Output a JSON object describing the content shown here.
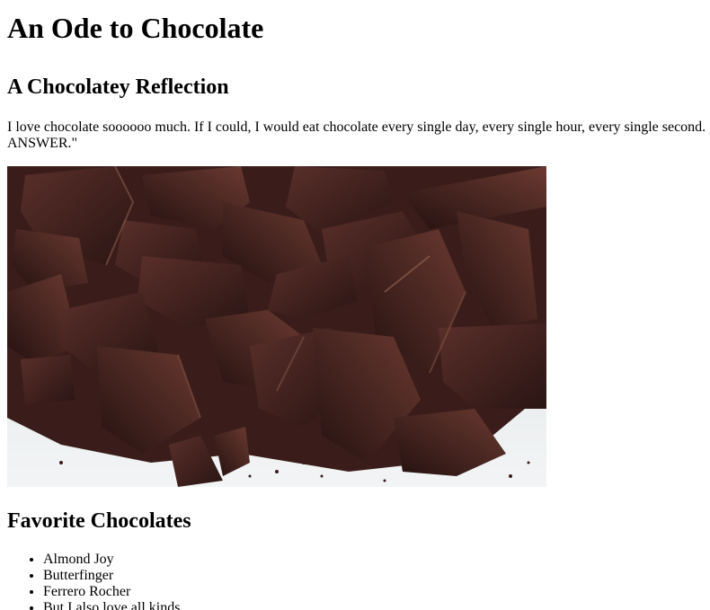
{
  "page": {
    "title": "An Ode to Chocolate",
    "reflection_heading": "A Chocolatey Reflection",
    "intro_text": "I love chocolate soooooo much. If I could, I would eat chocolate every single day, every single hour, every single second. “ANSWER.\"",
    "image_alt": "chocolate pieces",
    "favorites_heading": "Favorite Chocolates",
    "favorites": [
      "Almond Joy",
      "Butterfinger",
      "Ferrero Rocher",
      "But I also love all kinds."
    ]
  },
  "colors": {
    "background": "#ffffff",
    "text": "#000000",
    "chocolate_dark": "#2a1614",
    "chocolate_mid": "#4a2724",
    "chocolate_light": "#7a4a3c",
    "surface": "#eef1f3"
  }
}
